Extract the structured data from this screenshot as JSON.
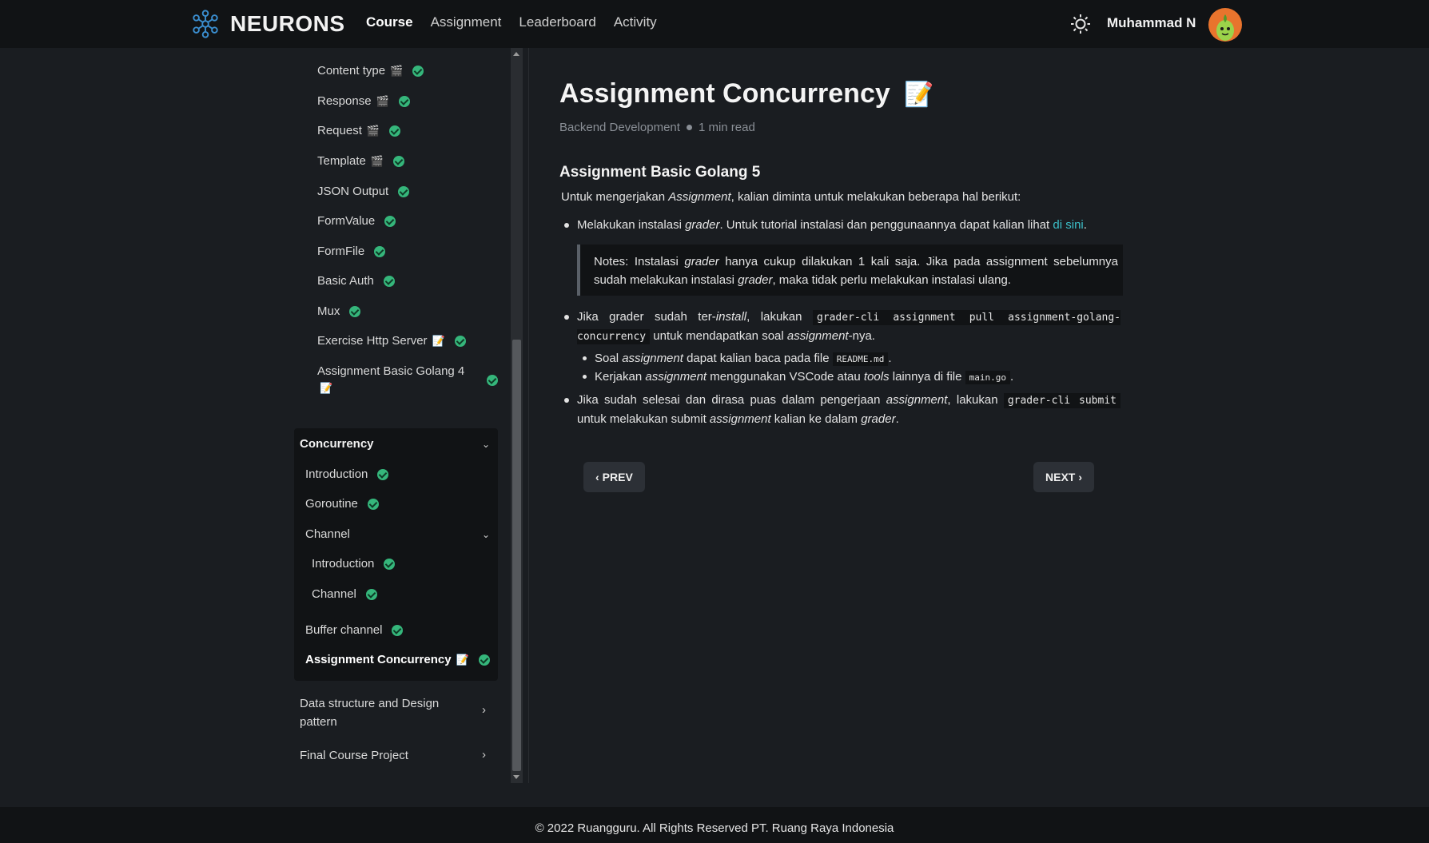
{
  "header": {
    "brand": "NEURONS",
    "nav": [
      "Course",
      "Assignment",
      "Leaderboard",
      "Activity"
    ],
    "active_nav": "Course",
    "user_name": "Muhammad N",
    "theme_icon": "sun-icon"
  },
  "sidebar": {
    "items": [
      {
        "label": "Content type",
        "icon": "video-icon"
      },
      {
        "label": "Response",
        "icon": "video-icon"
      },
      {
        "label": "Request",
        "icon": "video-icon"
      },
      {
        "label": "Template",
        "icon": "video-icon"
      },
      {
        "label": "JSON Output"
      },
      {
        "label": "FormValue"
      },
      {
        "label": "FormFile"
      },
      {
        "label": "Basic Auth"
      },
      {
        "label": "Mux"
      },
      {
        "label": "Exercise Http Server",
        "icon": "memo-icon"
      },
      {
        "label": "Assignment Basic Golang 4",
        "icon": "memo-icon"
      }
    ],
    "concurrency": {
      "title": "Concurrency",
      "items": [
        "Introduction",
        "Goroutine"
      ],
      "channel": {
        "title": "Channel",
        "items": [
          "Introduction",
          "Channel"
        ]
      },
      "after": [
        "Buffer channel",
        "Assignment Concurrency"
      ]
    },
    "collapsed": [
      "Data structure and Design pattern",
      "Final Course Project"
    ]
  },
  "content": {
    "title": "Assignment Concurrency",
    "title_icon": "memo-icon",
    "category": "Backend Development",
    "read_time": "1 min read",
    "section_title": "Assignment Basic Golang 5",
    "intro_a": "Untuk mengerjakan ",
    "intro_b": "Assignment",
    "intro_c": ", kalian diminta untuk melakukan beberapa hal berikut:",
    "b1_a": "Melakukan instalasi ",
    "b1_b": "grader",
    "b1_c": ". Untuk tutorial instalasi dan penggunaannya dapat kalian lihat ",
    "b1_link": "di sini",
    "b1_d": ".",
    "note_a": "Notes: Instalasi ",
    "note_b": "grader",
    "note_c": " hanya cukup dilakukan 1 kali saja. Jika pada assignment sebelumnya sudah melakukan instalasi ",
    "note_d": "grader",
    "note_e": ", maka tidak perlu melakukan instalasi ulang.",
    "b2_a": "Jika grader sudah ter-",
    "b2_b": "install",
    "b2_c": ", lakukan ",
    "b2_code": "grader-cli assignment pull assignment-golang-concurrency",
    "b2_d": " untuk mendapatkan soal ",
    "b2_e": "assignment",
    "b2_f": "-nya.",
    "s1_a": "Soal ",
    "s1_b": "assignment",
    "s1_c": " dapat kalian baca pada file ",
    "s1_code": "README.md",
    "s1_d": ".",
    "s2_a": "Kerjakan ",
    "s2_b": "assignment",
    "s2_c": " menggunakan VSCode atau ",
    "s2_d": "tools",
    "s2_e": " lainnya di file ",
    "s2_code": "main.go",
    "s2_f": ".",
    "b3_a": "Jika sudah selesai dan dirasa puas dalam pengerjaan ",
    "b3_b": "assignment",
    "b3_c": ", lakukan ",
    "b3_code": "grader-cli submit",
    "b3_d": " untuk melakukan submit ",
    "b3_e": "assignment",
    "b3_f": " kalian ke dalam ",
    "b3_g": "grader",
    "b3_h": ".",
    "prev": "PREV",
    "next": "NEXT"
  },
  "footer": "© 2022 Ruangguru. All Rights Reserved PT. Ruang Raya Indonesia"
}
